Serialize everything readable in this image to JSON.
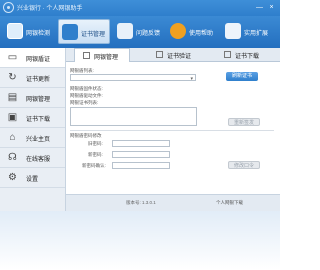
{
  "app": {
    "title": "兴业银行 · 个人网银助手",
    "window_buttons": [
      "—",
      "×"
    ]
  },
  "toolbar": {
    "items": [
      {
        "label": "网银检测",
        "icon": "shield-check-icon",
        "color": "#ffffff"
      },
      {
        "label": "证书管理",
        "icon": "certificate-icon",
        "color": "#2f7fcc"
      },
      {
        "label": "问题反馈",
        "icon": "feedback-icon",
        "color": "#ffffff"
      },
      {
        "label": "使用帮助",
        "icon": "help-icon",
        "color": "#f0a020"
      },
      {
        "label": "实用扩展",
        "icon": "extensions-icon",
        "color": "#ffffff"
      }
    ]
  },
  "sidebar": {
    "items": [
      {
        "label": "网银盾证",
        "icon": "usb-key-icon"
      },
      {
        "label": "证书更新",
        "icon": "refresh-icon"
      },
      {
        "label": "网银管理",
        "icon": "manage-icon"
      },
      {
        "label": "证书下载",
        "icon": "download-icon"
      },
      {
        "label": "兴业主页",
        "icon": "home-icon"
      },
      {
        "label": "在线客服",
        "icon": "headset-icon"
      },
      {
        "label": "设置",
        "icon": "settings-icon"
      }
    ]
  },
  "tabs": [
    {
      "label": "网银管理"
    },
    {
      "label": "证书验证"
    },
    {
      "label": "证书下载"
    }
  ],
  "form": {
    "key_select_label": "网银盾列表:",
    "key_select_value": "",
    "key_button": "刷新证书",
    "info_lines": [
      "网银盾固件状态:",
      "网银盾驱动文件:",
      "网银证书列表:"
    ],
    "info_button": "重新签发",
    "password_section_label": "网银盾密码修改",
    "old_password_label": "旧密码:",
    "new_password_label": "新密码:",
    "confirm_password_label": "新密码确认:",
    "password_button": "修改口令"
  },
  "status": {
    "version": "版本号: 1.3.0.1",
    "link": "个人网银下载"
  }
}
